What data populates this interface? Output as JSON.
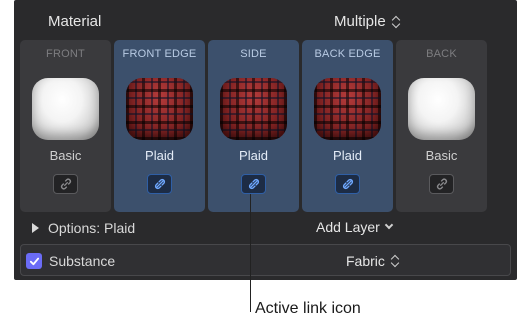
{
  "header": {
    "label": "Material",
    "value": "Multiple"
  },
  "cards": [
    {
      "title": "FRONT",
      "label": "Basic",
      "swatch": "basic",
      "active": false
    },
    {
      "title": "FRONT EDGE",
      "label": "Plaid",
      "swatch": "plaid",
      "active": true
    },
    {
      "title": "SIDE",
      "label": "Plaid",
      "swatch": "plaid",
      "active": true
    },
    {
      "title": "BACK EDGE",
      "label": "Plaid",
      "swatch": "plaid",
      "active": true
    },
    {
      "title": "BACK",
      "label": "Basic",
      "swatch": "basic",
      "active": false
    }
  ],
  "options": {
    "label": "Options: Plaid",
    "add_layer": "Add Layer"
  },
  "substance": {
    "label": "Substance",
    "value": "Fabric",
    "checked": true
  },
  "callout": {
    "text": "Active link icon"
  },
  "colors": {
    "active_card": "#3c506c",
    "link_active": "#2f5fa6",
    "checkbox": "#6b6cf6"
  }
}
